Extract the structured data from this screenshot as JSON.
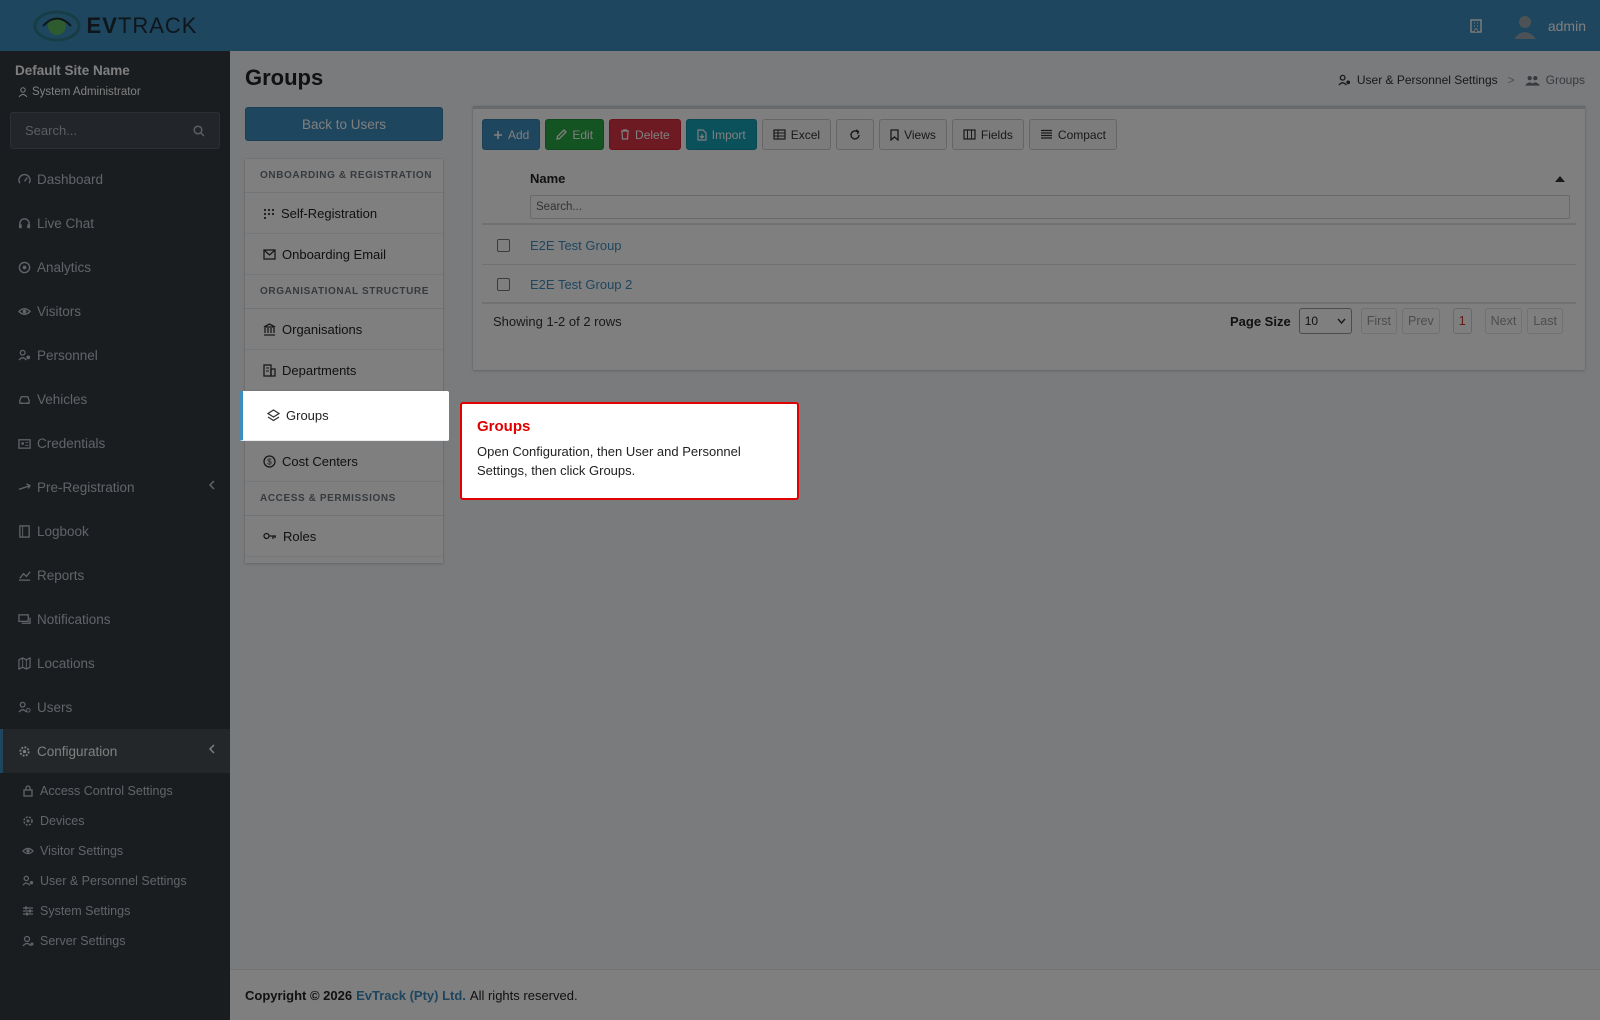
{
  "app": {
    "logo_text_bold": "EV",
    "logo_text": "TRACK"
  },
  "topbar": {
    "username": "admin"
  },
  "sidebar": {
    "site_name": "Default Site Name",
    "role": "System Administrator",
    "search_placeholder": "Search...",
    "items": [
      {
        "label": "Dashboard",
        "icon": "gauge-icon"
      },
      {
        "label": "Live Chat",
        "icon": "headset-icon"
      },
      {
        "label": "Analytics",
        "icon": "target-icon"
      },
      {
        "label": "Visitors",
        "icon": "eye-icon"
      },
      {
        "label": "Personnel",
        "icon": "user-gear-icon"
      },
      {
        "label": "Vehicles",
        "icon": "car-icon"
      },
      {
        "label": "Credentials",
        "icon": "id-card-icon"
      },
      {
        "label": "Pre-Registration",
        "icon": "arrows-icon"
      },
      {
        "label": "Logbook",
        "icon": "book-icon"
      },
      {
        "label": "Reports",
        "icon": "chart-icon"
      },
      {
        "label": "Notifications",
        "icon": "message-icon"
      },
      {
        "label": "Locations",
        "icon": "map-icon"
      },
      {
        "label": "Users",
        "icon": "users-icon"
      },
      {
        "label": "Configuration",
        "icon": "gear-icon"
      }
    ],
    "config_submenu": [
      {
        "label": "Access Control Settings",
        "icon": "lock-icon"
      },
      {
        "label": "Devices",
        "icon": "chip-icon"
      },
      {
        "label": "Visitor Settings",
        "icon": "eye-icon"
      },
      {
        "label": "User & Personnel Settings",
        "icon": "user-gear-icon"
      },
      {
        "label": "System Settings",
        "icon": "sliders-icon"
      },
      {
        "label": "Server Settings",
        "icon": "server-icon"
      }
    ]
  },
  "page": {
    "title": "Groups",
    "breadcrumb": {
      "parent": "User & Personnel Settings",
      "current": "Groups"
    },
    "back_button": "Back to Users"
  },
  "settings_menu": {
    "sections": [
      {
        "header": "ONBOARDING & REGISTRATION",
        "items": [
          {
            "label": "Self-Registration",
            "icon": "grid-icon"
          },
          {
            "label": "Onboarding Email",
            "icon": "envelope-icon"
          }
        ]
      },
      {
        "header": "ORGANISATIONAL STRUCTURE",
        "items": [
          {
            "label": "Organisations",
            "icon": "institution-icon"
          },
          {
            "label": "Departments",
            "icon": "building-icon"
          },
          {
            "label": "Groups",
            "icon": "layers-icon"
          },
          {
            "label": "Cost Centers",
            "icon": "dollar-icon"
          }
        ]
      },
      {
        "header": "ACCESS & PERMISSIONS",
        "items": [
          {
            "label": "Roles",
            "icon": "key-icon"
          }
        ]
      }
    ]
  },
  "toolbar": {
    "add": "Add",
    "edit": "Edit",
    "delete": "Delete",
    "import": "Import",
    "excel": "Excel",
    "views": "Views",
    "fields": "Fields",
    "compact": "Compact"
  },
  "table": {
    "column": "Name",
    "filter_placeholder": "Search...",
    "rows": [
      "E2E Test Group",
      "E2E Test Group 2"
    ],
    "showing": "Showing 1-2 of 2 rows",
    "page_size_label": "Page Size",
    "page_size": "10",
    "first": "First",
    "prev": "Prev",
    "page": "1",
    "next": "Next",
    "last": "Last"
  },
  "tooltip": {
    "title": "Groups",
    "body": "Open Configuration, then User and Personnel Settings, then click Groups."
  },
  "footer": {
    "copyright": "Copyright © 2026",
    "company": "EvTrack (Pty) Ltd.",
    "rights": "All rights reserved."
  }
}
